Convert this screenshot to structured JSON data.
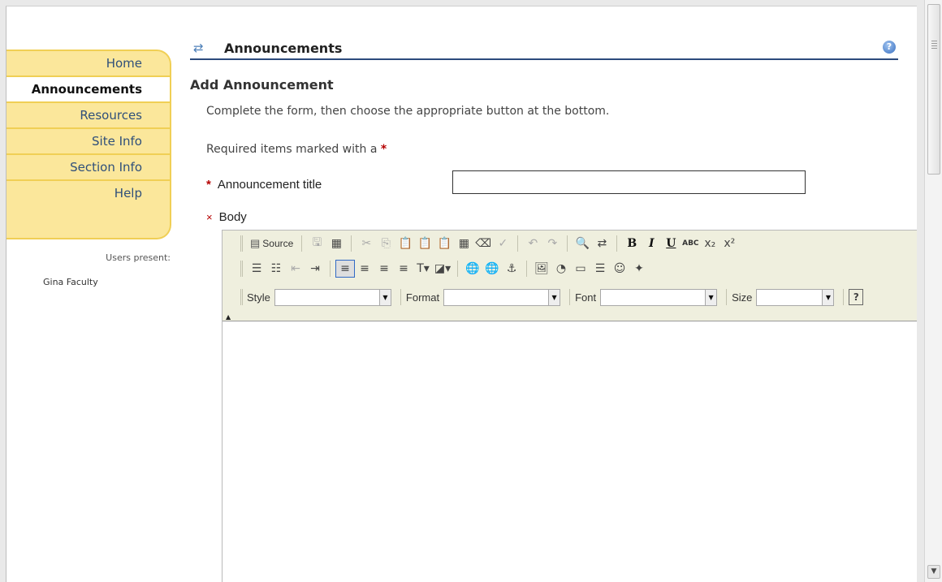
{
  "nav": {
    "items": [
      {
        "label": "Home",
        "active": false
      },
      {
        "label": "Announcements",
        "active": true
      },
      {
        "label": "Resources",
        "active": false
      },
      {
        "label": "Site Info",
        "active": false
      },
      {
        "label": "Section Info",
        "active": false
      },
      {
        "label": "Help",
        "active": false
      }
    ],
    "users_present_label": "Users present:",
    "users": [
      "Gina Faculty"
    ]
  },
  "tool": {
    "title": "Announcements",
    "title_icon": "reset-arrows-icon",
    "help_icon": "help-icon",
    "help_glyph": "?"
  },
  "form": {
    "heading": "Add Announcement",
    "instructions": "Complete the form, then choose the appropriate button at the bottom.",
    "required_note": "Required items marked with a",
    "required_marker": "*",
    "title_label": "Announcement title",
    "title_value": "",
    "body_label": "Body"
  },
  "editor": {
    "row1": [
      {
        "name": "source-button",
        "label": "Source",
        "glyph": "▤"
      },
      "sep",
      {
        "name": "save-icon",
        "glyph": "🖫",
        "dim": true
      },
      {
        "name": "templates-icon",
        "glyph": "▦"
      },
      "sep",
      {
        "name": "cut-icon",
        "glyph": "✂",
        "dim": true
      },
      {
        "name": "copy-icon",
        "glyph": "⎘",
        "dim": true
      },
      {
        "name": "paste-icon",
        "glyph": "📋"
      },
      {
        "name": "paste-text-icon",
        "glyph": "📋"
      },
      {
        "name": "paste-word-icon",
        "glyph": "📋"
      },
      {
        "name": "print-icon",
        "glyph": "▦"
      },
      {
        "name": "eraser-icon",
        "glyph": "⌫"
      },
      {
        "name": "spellcheck-icon",
        "glyph": "✓",
        "dim": true
      },
      "sep",
      {
        "name": "undo-icon",
        "glyph": "↶",
        "dim": true
      },
      {
        "name": "redo-icon",
        "glyph": "↷",
        "dim": true
      },
      "sep",
      {
        "name": "find-icon",
        "glyph": "🔍"
      },
      {
        "name": "replace-icon",
        "glyph": "⇄"
      },
      "sep",
      {
        "name": "bold-icon",
        "glyph": "B",
        "style": "bold"
      },
      {
        "name": "italic-icon",
        "glyph": "I",
        "style": "ital"
      },
      {
        "name": "underline-icon",
        "glyph": "U",
        "style": "und"
      },
      {
        "name": "strikethrough-icon",
        "glyph": "ABC",
        "style": "small"
      },
      {
        "name": "subscript-icon",
        "glyph": "x₂"
      },
      {
        "name": "superscript-icon",
        "glyph": "x²"
      }
    ],
    "row2": [
      {
        "name": "numbered-list-icon",
        "glyph": "☰"
      },
      {
        "name": "bulleted-list-icon",
        "glyph": "☷"
      },
      {
        "name": "outdent-icon",
        "glyph": "⇤",
        "dim": true
      },
      {
        "name": "indent-icon",
        "glyph": "⇥"
      },
      "sep",
      {
        "name": "align-left-icon",
        "glyph": "≡",
        "active": true
      },
      {
        "name": "align-center-icon",
        "glyph": "≡"
      },
      {
        "name": "align-right-icon",
        "glyph": "≡"
      },
      {
        "name": "justify-icon",
        "glyph": "≡"
      },
      {
        "name": "text-color-icon",
        "glyph": "T▾"
      },
      {
        "name": "bg-color-icon",
        "glyph": "◪▾"
      },
      "sep",
      {
        "name": "link-icon",
        "glyph": "🌐"
      },
      {
        "name": "unlink-icon",
        "glyph": "🌐",
        "dim": true
      },
      {
        "name": "anchor-icon",
        "glyph": "⚓"
      },
      "sep",
      {
        "name": "image-icon",
        "glyph": "🖼"
      },
      {
        "name": "flash-icon",
        "glyph": "◔"
      },
      {
        "name": "table-icon",
        "glyph": "▭"
      },
      {
        "name": "horizontal-rule-icon",
        "glyph": "☰"
      },
      {
        "name": "smiley-icon",
        "glyph": "☺"
      },
      {
        "name": "special-char-icon",
        "glyph": "✦"
      }
    ],
    "combos": [
      {
        "name": "style",
        "label": "Style",
        "value": ""
      },
      {
        "name": "format",
        "label": "Format",
        "value": ""
      },
      {
        "name": "font",
        "label": "Font",
        "value": ""
      },
      {
        "name": "size",
        "label": "Size",
        "value": ""
      }
    ],
    "about_glyph": "?",
    "collapse_glyph": "▲",
    "combo_arrow_glyph": "▼"
  },
  "scrollbar": {
    "down_arrow": "▼"
  },
  "colors": {
    "nav_bg": "#fbe79b",
    "nav_border": "#f0cf55",
    "title_rule": "#2c4a7c",
    "required": "#b50000",
    "toolbar_bg": "#efefde"
  }
}
